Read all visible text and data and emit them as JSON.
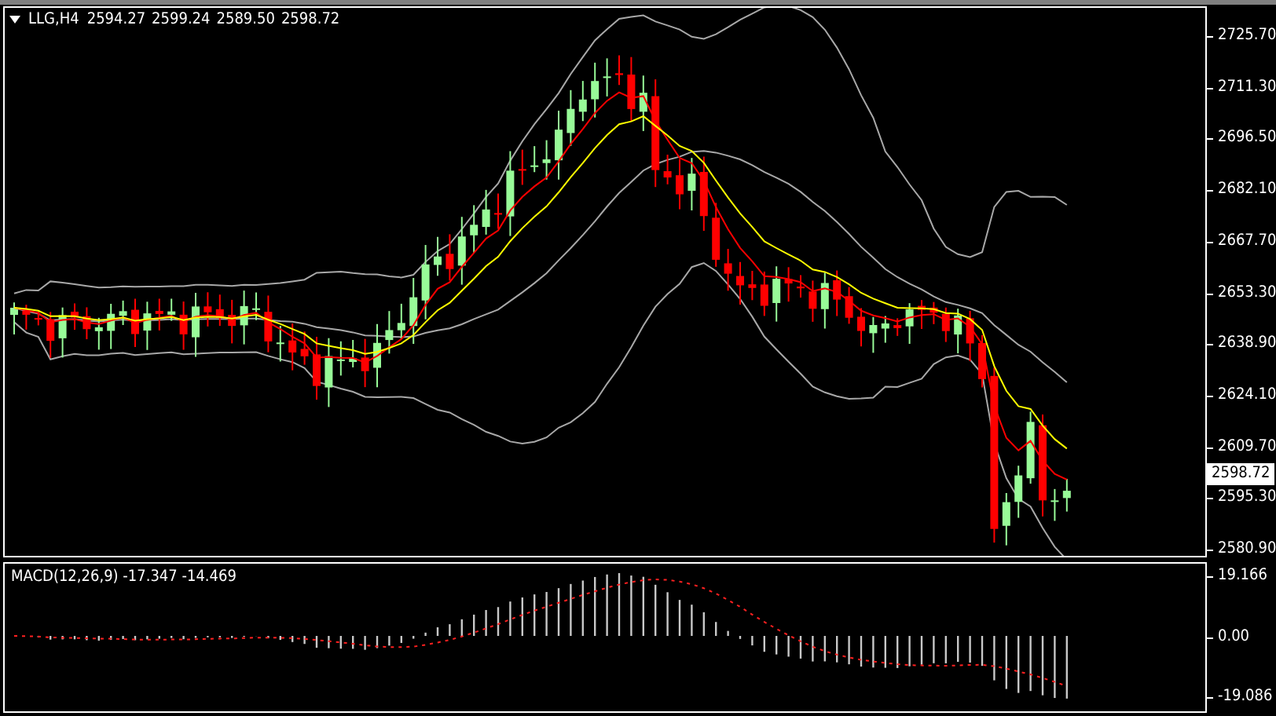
{
  "price_chart": {
    "symbol": "LLG,H4",
    "ohlc": [
      "2594.27",
      "2599.24",
      "2589.50",
      "2598.72"
    ],
    "price_axis": [
      "2725.70",
      "2711.30",
      "2696.50",
      "2682.10",
      "2667.70",
      "2653.30",
      "2638.90",
      "2624.10",
      "2609.70",
      "2595.30",
      "2580.90"
    ],
    "current_price": "2598.72"
  },
  "macd_pane": {
    "label": "MACD(12,26,9) -17.347 -14.469",
    "axis": [
      "19.166",
      "0.00",
      "-19.086"
    ]
  }
}
